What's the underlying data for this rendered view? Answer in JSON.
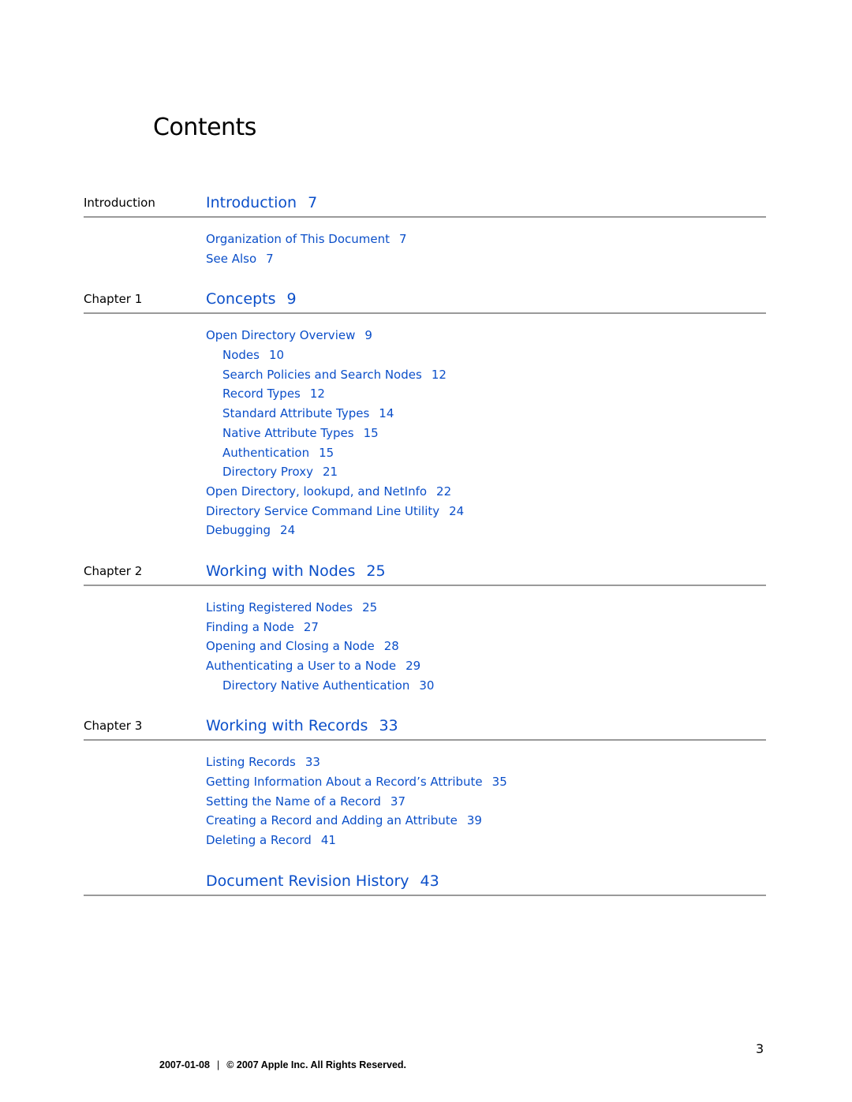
{
  "page_title": "Contents",
  "sections": [
    {
      "label": "Introduction",
      "title": "Introduction",
      "page": "7",
      "entries": [
        {
          "text": "Organization of This Document",
          "page": "7",
          "level": 1
        },
        {
          "text": "See Also",
          "page": "7",
          "level": 1
        }
      ]
    },
    {
      "label": "Chapter 1",
      "title": "Concepts",
      "page": "9",
      "entries": [
        {
          "text": "Open Directory Overview",
          "page": "9",
          "level": 1
        },
        {
          "text": "Nodes",
          "page": "10",
          "level": 2
        },
        {
          "text": "Search Policies and Search Nodes",
          "page": "12",
          "level": 2
        },
        {
          "text": "Record Types",
          "page": "12",
          "level": 2
        },
        {
          "text": "Standard Attribute Types",
          "page": "14",
          "level": 2
        },
        {
          "text": "Native Attribute Types",
          "page": "15",
          "level": 2
        },
        {
          "text": "Authentication",
          "page": "15",
          "level": 2
        },
        {
          "text": "Directory Proxy",
          "page": "21",
          "level": 2
        },
        {
          "text": "Open Directory, lookupd, and NetInfo",
          "page": "22",
          "level": 1
        },
        {
          "text": "Directory Service Command Line Utility",
          "page": "24",
          "level": 1
        },
        {
          "text": "Debugging",
          "page": "24",
          "level": 1
        }
      ]
    },
    {
      "label": "Chapter 2",
      "title": "Working with Nodes",
      "page": "25",
      "entries": [
        {
          "text": "Listing Registered Nodes",
          "page": "25",
          "level": 1
        },
        {
          "text": "Finding a Node",
          "page": "27",
          "level": 1
        },
        {
          "text": "Opening and Closing a Node",
          "page": "28",
          "level": 1
        },
        {
          "text": "Authenticating a User to a Node",
          "page": "29",
          "level": 1
        },
        {
          "text": "Directory Native Authentication",
          "page": "30",
          "level": 2
        }
      ]
    },
    {
      "label": "Chapter 3",
      "title": "Working with Records",
      "page": "33",
      "entries": [
        {
          "text": "Listing Records",
          "page": "33",
          "level": 1
        },
        {
          "text": "Getting Information About a Record’s Attribute",
          "page": "35",
          "level": 1
        },
        {
          "text": "Setting the Name of a Record",
          "page": "37",
          "level": 1
        },
        {
          "text": "Creating a Record and Adding an Attribute",
          "page": "39",
          "level": 1
        },
        {
          "text": "Deleting a Record",
          "page": "41",
          "level": 1
        }
      ]
    },
    {
      "label": "",
      "title": "Document Revision History",
      "page": "43",
      "entries": []
    }
  ],
  "page_number": "3",
  "footer": {
    "date": "2007-01-08",
    "separator": "|",
    "copyright": "© 2007 Apple Inc. All Rights Reserved."
  },
  "colors": {
    "link": "#0b4fc9",
    "rule": "#9a9a9a",
    "text": "#000000"
  }
}
